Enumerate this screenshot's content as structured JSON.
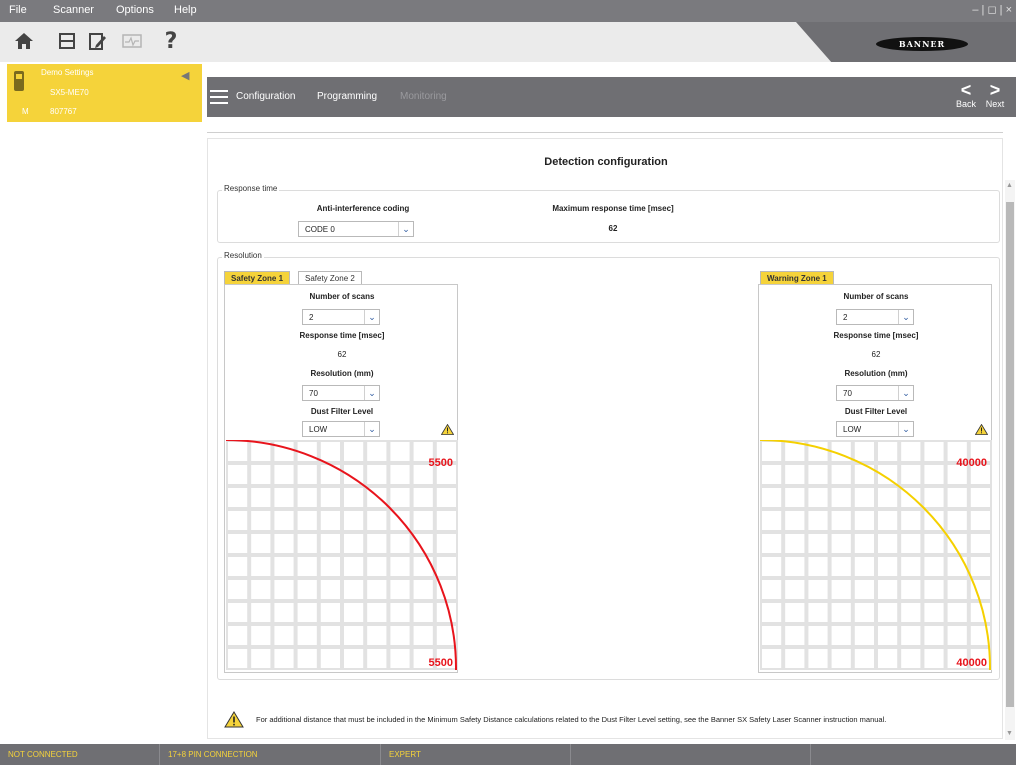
{
  "menu": {
    "items": [
      "File",
      "Scanner",
      "Options",
      "Help"
    ],
    "window_controls": "– | ◻ | ×"
  },
  "toolbar": {
    "icons": [
      "home-icon",
      "save-icon",
      "edit-document-icon",
      "monitor-icon",
      "help-icon"
    ],
    "help_glyph": "?"
  },
  "brand": {
    "logo_text": "BANNER"
  },
  "device": {
    "name": "Demo Settings",
    "model": "SX5-ME70",
    "mode_letter": "M",
    "serial": "807767"
  },
  "nav": {
    "tabs": [
      "Configuration",
      "Programming",
      "Monitoring"
    ],
    "back_label": "Back",
    "next_label": "Next"
  },
  "page": {
    "heading": "Detection configuration",
    "response_time": {
      "group_title": "Response time",
      "anti_interference_label": "Anti-interference coding",
      "anti_interference_value": "CODE 0",
      "max_response_label": "Maximum response time [msec]",
      "max_response_value": "62"
    },
    "resolution": {
      "group_title": "Resolution",
      "safety_tabs": [
        "Safety Zone 1",
        "Safety Zone 2"
      ],
      "warning_tabs": [
        "Warning Zone 1"
      ],
      "safety": {
        "scans_label": "Number of scans",
        "scans_value": "2",
        "response_label": "Response time [msec]",
        "response_value": "62",
        "resolution_label": "Resolution (mm)",
        "resolution_value": "70",
        "dust_label": "Dust Filter Level",
        "dust_value": "LOW",
        "range_top": "5500",
        "range_bottom": "5500",
        "arc_color": "#e8141c"
      },
      "warning": {
        "scans_label": "Number of scans",
        "scans_value": "2",
        "response_label": "Response time [msec]",
        "response_value": "62",
        "resolution_label": "Resolution (mm)",
        "resolution_value": "70",
        "dust_label": "Dust Filter Level",
        "dust_value": "LOW",
        "range_top": "40000",
        "range_bottom": "40000",
        "arc_color": "#f5d000"
      }
    },
    "footnote": "For additional distance that must be included in the Minimum Safety Distance calculations related to the Dust Filter Level setting, see the Banner SX Safety Laser Scanner instruction manual."
  },
  "status": {
    "connection": "NOT CONNECTED",
    "pin": "17+8 PIN CONNECTION",
    "level": "EXPERT"
  },
  "colors": {
    "accent": "#f5d33a",
    "bar": "#6f6f73",
    "link_blue": "#2d5aa0",
    "range_red": "#e8141c"
  }
}
